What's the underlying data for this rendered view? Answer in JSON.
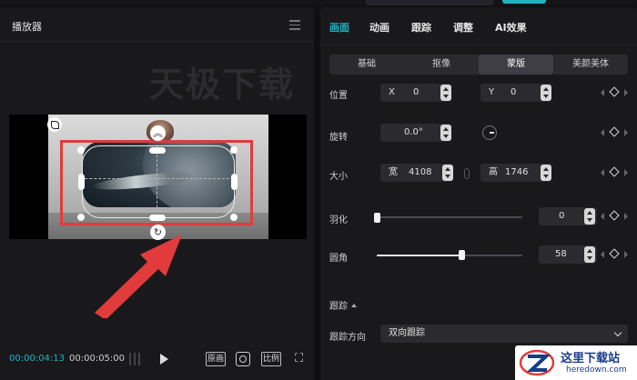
{
  "player": {
    "title": "播放器",
    "watermark": "天极下载",
    "time_current": "00:00:04:13",
    "time_total": "00:00:05:00",
    "btn_original": "原画",
    "btn_ratio": "比例"
  },
  "tabs": [
    "画面",
    "动画",
    "跟踪",
    "调整",
    "AI效果"
  ],
  "subtabs": [
    "基础",
    "抠像",
    "蒙版",
    "美颜美体"
  ],
  "position": {
    "label": "位置",
    "x_prefix": "X",
    "x_value": "0",
    "y_prefix": "Y",
    "y_value": "0"
  },
  "rotation": {
    "label": "旋转",
    "value": "0.0°"
  },
  "size": {
    "label": "大小",
    "w_prefix": "宽",
    "w_value": "4108",
    "h_prefix": "高",
    "h_value": "1746"
  },
  "feather": {
    "label": "羽化",
    "value": "0",
    "level": 0.0
  },
  "corner": {
    "label": "圆角",
    "value": "58",
    "level": 0.58
  },
  "tracking": {
    "section": "跟踪",
    "direction_label": "跟踪方向",
    "direction_value": "双向跟踪"
  },
  "site": {
    "title": "这里下载站",
    "url": "heredown.com"
  },
  "colors": {
    "accent": "#1fb3c0",
    "annotation": "#e23b3b"
  }
}
